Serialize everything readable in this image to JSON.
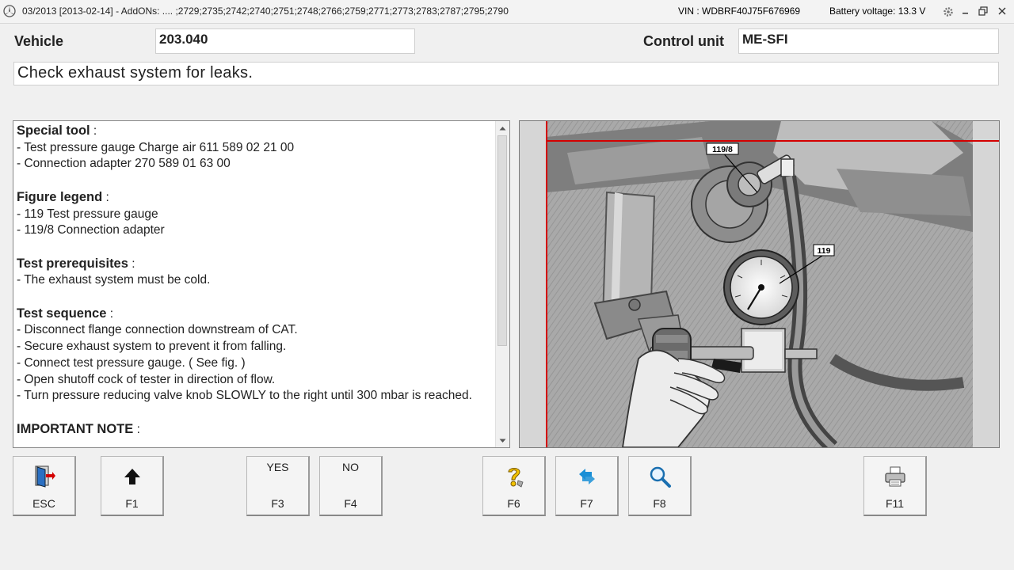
{
  "titlebar": {
    "title": "03/2013 [2013-02-14] - AddONs:  .... ;2729;2735;2742;2740;2751;2748;2766;2759;2771;2773;2783;2787;2795;2790",
    "vin": "VIN : WDBRF40J75F676969",
    "battery": "Battery voltage: 13.3 V"
  },
  "header": {
    "vehicle_label": "Vehicle",
    "vehicle_value": "203.040",
    "control_unit_label": "Control unit",
    "control_unit_value": "ME-SFI"
  },
  "instruction": "Check exhaust system for leaks.",
  "content": {
    "special_tool_title": "Special tool",
    "special_tool_lines": [
      "- Test pressure gauge Charge air 611 589 02 21 00",
      "- Connection adapter 270 589 01 63 00"
    ],
    "figure_legend_title": "Figure legend",
    "figure_legend_lines": [
      "- 119 Test pressure gauge",
      "- 119/8 Connection adapter"
    ],
    "prerequisites_title": "Test prerequisites",
    "prerequisites_lines": [
      "- The exhaust system must be cold."
    ],
    "sequence_title": "Test sequence",
    "sequence_lines": [
      "- Disconnect flange connection downstream of CAT.",
      "- Secure exhaust system to prevent it from falling.",
      "- Connect test pressure gauge. ( See fig. )",
      "- Open shutoff cock of tester in direction of flow.",
      "- Turn pressure reducing valve knob SLOWLY to the right until 300 mbar is reached."
    ],
    "important_title": "IMPORTANT NOTE",
    "colon": " :"
  },
  "figure": {
    "label_adapter": "119/8",
    "label_gauge": "119"
  },
  "fkeys": {
    "esc": "ESC",
    "f1": "F1",
    "f3_top": "YES",
    "f3": "F3",
    "f4_top": "NO",
    "f4": "F4",
    "f6": "F6",
    "f7": "F7",
    "f8": "F8",
    "f11": "F11"
  },
  "colors": {
    "accent_red": "#d40000",
    "help_yellow": "#f2c200",
    "nav_blue": "#1a8fd6"
  }
}
